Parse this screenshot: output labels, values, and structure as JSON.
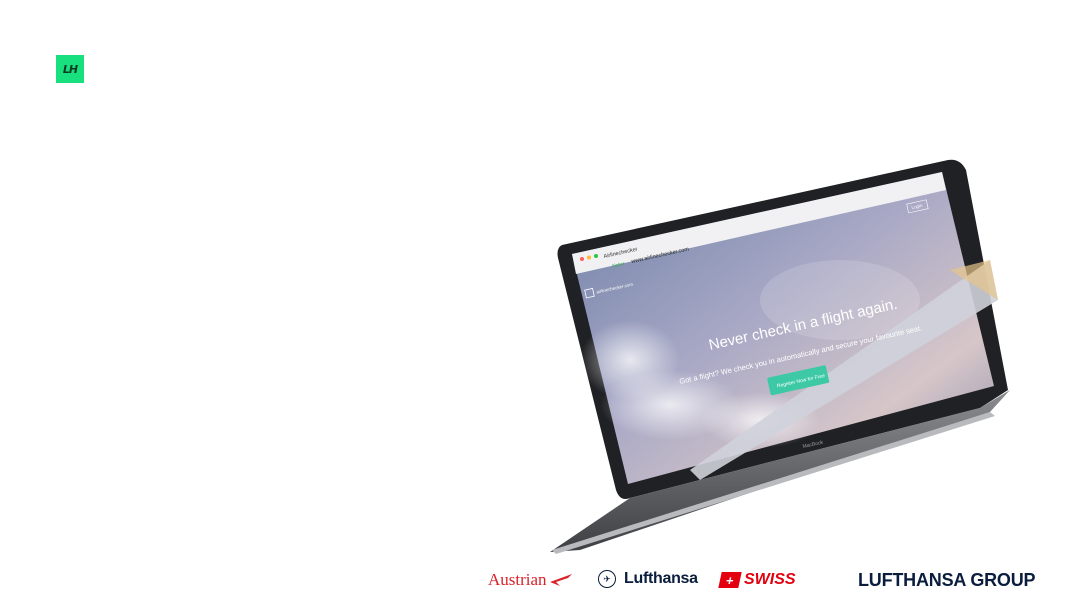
{
  "brand": {
    "mark_text": "LH",
    "mark_color": "#19e07f"
  },
  "laptop": {
    "model_label": "MacBook",
    "browser": {
      "tab_title": "Airlinechecker",
      "secure_label": "Sicher",
      "address": "www.airlinechecker.com"
    },
    "website": {
      "logo_text": "airlinechecker.com",
      "nav_login": "Login",
      "headline": "Never check in a flight again.",
      "subline": "Got a flight? We check you in automatically and secure your favourite seat.",
      "cta_label": "Register Now for Free",
      "cta_color": "#3dc9a5"
    }
  },
  "footer": {
    "austrian": "Austrian",
    "lufthansa": "Lufthansa",
    "swiss": "SWISS",
    "group": "LUFTHANSA GROUP"
  }
}
